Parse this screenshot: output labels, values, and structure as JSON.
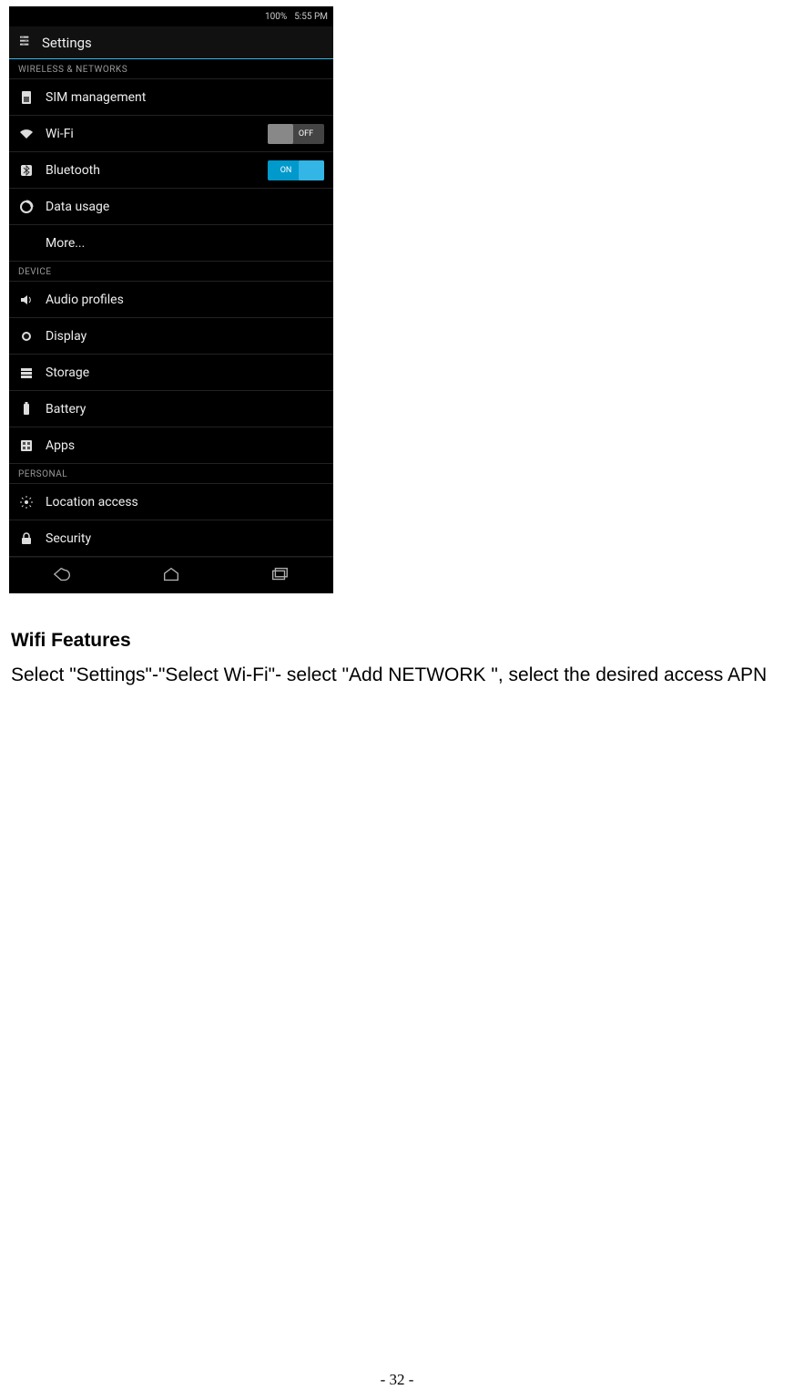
{
  "statusbar": {
    "battery_pct": "100%",
    "time": "5:55 PM"
  },
  "titlebar": {
    "title": "Settings"
  },
  "sections": {
    "wireless": {
      "header": "WIRELESS & NETWORKS",
      "items": {
        "sim": "SIM management",
        "wifi": "Wi-Fi",
        "wifi_toggle": "OFF",
        "bluetooth": "Bluetooth",
        "bluetooth_toggle": "ON",
        "data": "Data usage",
        "more": "More..."
      }
    },
    "device": {
      "header": "DEVICE",
      "items": {
        "audio": "Audio profiles",
        "display": "Display",
        "storage": "Storage",
        "battery": "Battery",
        "apps": "Apps"
      }
    },
    "personal": {
      "header": "PERSONAL",
      "items": {
        "location": "Location access",
        "security": "Security"
      }
    }
  },
  "document": {
    "heading": "Wifi Features",
    "body": "Select \"Settings\"-\"Select Wi-Fi\"- select \"Add NETWORK \", select the desired access APN",
    "page_num": "- 32 -"
  }
}
